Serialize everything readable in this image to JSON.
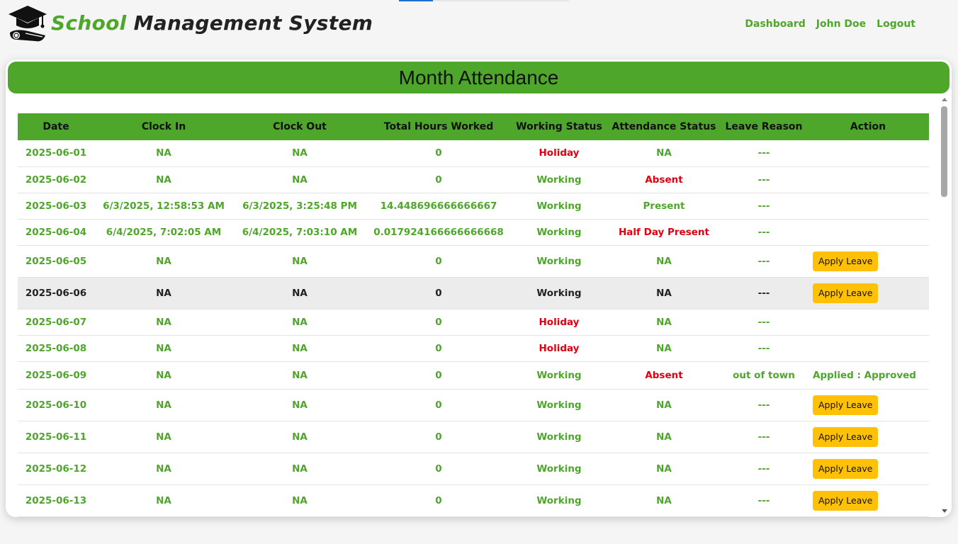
{
  "brand": {
    "word1": "School",
    "word2": "Management System"
  },
  "nav": [
    {
      "label": "Dashboard",
      "name": "nav-dashboard"
    },
    {
      "label": "John Doe",
      "name": "nav-user"
    },
    {
      "label": "Logout",
      "name": "nav-logout"
    }
  ],
  "page_title": "Month Attendance",
  "columns": [
    "Date",
    "Clock In",
    "Clock Out",
    "Total Hours Worked",
    "Working Status",
    "Attendance Status",
    "Leave Reason",
    "Action"
  ],
  "rows": [
    {
      "date": "2025-06-01",
      "in": "NA",
      "out": "NA",
      "hours": "0",
      "work": "Holiday",
      "att": "NA",
      "reason": "---",
      "action": ""
    },
    {
      "date": "2025-06-02",
      "in": "NA",
      "out": "NA",
      "hours": "0",
      "work": "Working",
      "att": "Absent",
      "reason": "---",
      "action": ""
    },
    {
      "date": "2025-06-03",
      "in": "6/3/2025, 12:58:53 AM",
      "out": "6/3/2025, 3:25:48 PM",
      "hours": "14.448696666666667",
      "work": "Working",
      "att": "Present",
      "reason": "---",
      "action": ""
    },
    {
      "date": "2025-06-04",
      "in": "6/4/2025, 7:02:05 AM",
      "out": "6/4/2025, 7:03:10 AM",
      "hours": "0.017924166666666668",
      "work": "Working",
      "att": "Half Day Present",
      "reason": "---",
      "action": ""
    },
    {
      "date": "2025-06-05",
      "in": "NA",
      "out": "NA",
      "hours": "0",
      "work": "Working",
      "att": "NA",
      "reason": "---",
      "action": "Apply Leave"
    },
    {
      "date": "2025-06-06",
      "in": "NA",
      "out": "NA",
      "hours": "0",
      "work": "Working",
      "att": "NA",
      "reason": "---",
      "action": "Apply Leave"
    },
    {
      "date": "2025-06-07",
      "in": "NA",
      "out": "NA",
      "hours": "0",
      "work": "Holiday",
      "att": "NA",
      "reason": "---",
      "action": ""
    },
    {
      "date": "2025-06-08",
      "in": "NA",
      "out": "NA",
      "hours": "0",
      "work": "Holiday",
      "att": "NA",
      "reason": "---",
      "action": ""
    },
    {
      "date": "2025-06-09",
      "in": "NA",
      "out": "NA",
      "hours": "0",
      "work": "Working",
      "att": "Absent",
      "reason": "out of town",
      "action": "Applied : Approved"
    },
    {
      "date": "2025-06-10",
      "in": "NA",
      "out": "NA",
      "hours": "0",
      "work": "Working",
      "att": "NA",
      "reason": "---",
      "action": "Apply Leave"
    },
    {
      "date": "2025-06-11",
      "in": "NA",
      "out": "NA",
      "hours": "0",
      "work": "Working",
      "att": "NA",
      "reason": "---",
      "action": "Apply Leave"
    },
    {
      "date": "2025-06-12",
      "in": "NA",
      "out": "NA",
      "hours": "0",
      "work": "Working",
      "att": "NA",
      "reason": "---",
      "action": "Apply Leave"
    },
    {
      "date": "2025-06-13",
      "in": "NA",
      "out": "NA",
      "hours": "0",
      "work": "Working",
      "att": "NA",
      "reason": "---",
      "action": "Apply Leave"
    }
  ],
  "highlighted_row": "2025-06-06",
  "colors": {
    "accent": "#4ea62a",
    "alert": "#e0000f",
    "button": "#ffc107"
  },
  "icons": {
    "logo": "graduation-cap-diploma-icon"
  }
}
